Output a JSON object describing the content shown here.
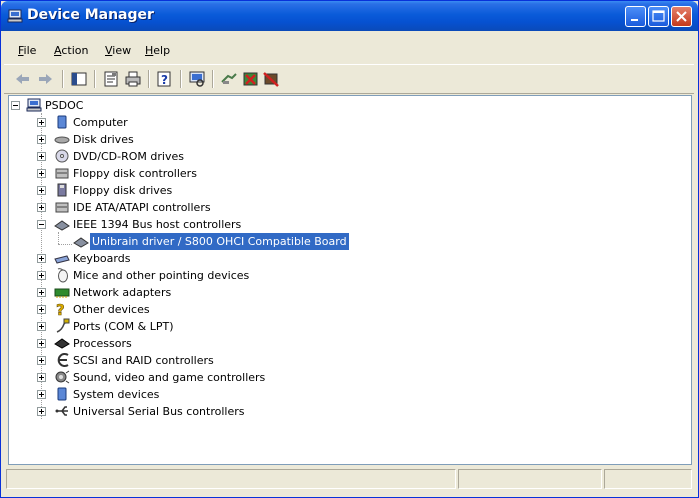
{
  "window": {
    "title": "Device Manager"
  },
  "menu": [
    {
      "label": "File",
      "accel": "F",
      "rest": "ile"
    },
    {
      "label": "Action",
      "accel": "A",
      "rest": "ction"
    },
    {
      "label": "View",
      "accel": "V",
      "rest": "iew"
    },
    {
      "label": "Help",
      "accel": "H",
      "rest": "elp"
    }
  ],
  "toolbar": {
    "buttons": [
      "back-icon",
      "forward-icon",
      "show-hide-console-tree-icon",
      "properties-icon",
      "print-icon",
      "help-icon",
      "scan-hardware-icon",
      "update-driver-icon",
      "uninstall-icon",
      "disable-icon"
    ]
  },
  "tree": {
    "root": "PSDOC",
    "items": [
      {
        "label": "Computer",
        "icon": "computer-icon",
        "expanded": false
      },
      {
        "label": "Disk drives",
        "icon": "disk-drive-icon",
        "expanded": false
      },
      {
        "label": "DVD/CD-ROM drives",
        "icon": "cdrom-icon",
        "expanded": false
      },
      {
        "label": "Floppy disk controllers",
        "icon": "floppy-controller-icon",
        "expanded": false
      },
      {
        "label": "Floppy disk drives",
        "icon": "floppy-drive-icon",
        "expanded": false
      },
      {
        "label": "IDE ATA/ATAPI controllers",
        "icon": "ide-controller-icon",
        "expanded": false
      },
      {
        "label": "IEEE 1394 Bus host controllers",
        "icon": "ieee1394-icon",
        "expanded": true
      },
      {
        "label": "Unibrain driver / S800 OHCI Compatible Board",
        "icon": "ieee1394-device-icon",
        "child": true,
        "selected": true
      },
      {
        "label": "Keyboards",
        "icon": "keyboard-icon",
        "expanded": false
      },
      {
        "label": "Mice and other pointing devices",
        "icon": "mouse-icon",
        "expanded": false
      },
      {
        "label": "Network adapters",
        "icon": "network-adapter-icon",
        "expanded": false
      },
      {
        "label": "Other devices",
        "icon": "unknown-device-icon",
        "expanded": false
      },
      {
        "label": "Ports (COM & LPT)",
        "icon": "port-icon",
        "expanded": false
      },
      {
        "label": "Processors",
        "icon": "processor-icon",
        "expanded": false
      },
      {
        "label": "SCSI and RAID controllers",
        "icon": "scsi-icon",
        "expanded": false
      },
      {
        "label": "Sound, video and game controllers",
        "icon": "sound-icon",
        "expanded": false
      },
      {
        "label": "System devices",
        "icon": "system-devices-icon",
        "expanded": false
      },
      {
        "label": "Universal Serial Bus controllers",
        "icon": "usb-icon",
        "expanded": false
      }
    ]
  },
  "colors": {
    "titlebar": "#0a5bd9",
    "selection": "#316ac5",
    "face": "#ece9d8"
  }
}
